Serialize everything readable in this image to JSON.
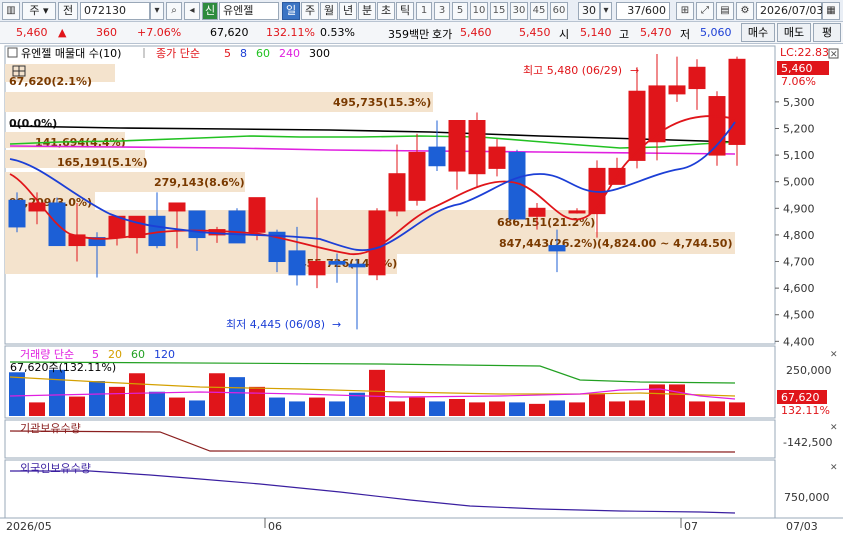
{
  "toolbar": {
    "view_mode": "주",
    "prev_label": "전",
    "stock_code": "072130",
    "market_badge": "신",
    "stock_name": "유엔젤",
    "periods": [
      "일",
      "주",
      "월",
      "년",
      "분",
      "초",
      "틱"
    ],
    "active_period": "일",
    "intervals": [
      "1",
      "3",
      "5",
      "10",
      "15",
      "30",
      "45",
      "60"
    ],
    "interval_value": "30",
    "count_value": "37/600",
    "date_value": "2026/07/03"
  },
  "quote": {
    "price": "5,460",
    "change": "360",
    "change_pct": "+7.06%",
    "volume": "67,620",
    "volume_ratio": "132.11%",
    "turnover": "0.53%",
    "amount": "359백만",
    "ask_label": "호가",
    "ask1": "5,460",
    "ask2": "5,450",
    "open_label": "시",
    "open": "5,140",
    "high_label": "고",
    "high": "5,470",
    "low_label": "저",
    "low": "5,060",
    "buy_button": "매수",
    "sell_button": "매도",
    "eval_button": "평"
  },
  "price_panel": {
    "legend_name": "유엔젤 매물대 수(10)",
    "ma_legend_label": "종가 단순",
    "ma_periods": [
      "5",
      "8",
      "60",
      "240",
      "300"
    ],
    "ma_colors": [
      "#e0151a",
      "#1c3fd6",
      "#22c122",
      "#e020e0",
      "#000000"
    ],
    "lc_label": "LC:22.83",
    "current_price_tag": "5,460",
    "current_pct_tag": "7.06%",
    "high_annotation": "최고 5,480 (06/29)",
    "low_annotation": "최저 4,445 (06/08)",
    "range_annotation": "(4,824.00 ~ 4,744.50)",
    "y_ticks": [
      "5,300",
      "5,200",
      "5,100",
      "5,000",
      "4,900",
      "4,800",
      "4,700",
      "4,600",
      "4,500",
      "4,400"
    ],
    "volume_profile_labels": [
      "67,620(2.1%)",
      "0(0.0%)",
      "495,735(15.3%)",
      "141,694(4.4%)",
      "165,191(5.1%)",
      "279,143(8.6%)",
      "98,209(3.0%)",
      "686,151(21.2%)",
      "847,443(26.2%)",
      "455,726(14.1%)"
    ]
  },
  "volume_panel": {
    "legend_label": "거래량 단순",
    "ma_periods": [
      "5",
      "20",
      "60",
      "120"
    ],
    "ma_colors": [
      "#e020e0",
      "#d4a000",
      "#22a022",
      "#1c3fd6"
    ],
    "info_label": "67,620주(132.11%)",
    "y_tick": "250,000",
    "current_tag": "67,620",
    "current_pct": "132.11%"
  },
  "institution_panel": {
    "legend_label": "기관보유수량",
    "y_tick": "-142,500"
  },
  "foreign_panel": {
    "legend_label": "외국인보유수량",
    "y_tick": "750,000"
  },
  "x_axis": {
    "labels": [
      "2026/05",
      "06",
      "07"
    ],
    "end_label": "07/03"
  },
  "chart_data": {
    "type": "candlestick",
    "ylim": [
      4390,
      5510
    ],
    "candles": [
      {
        "o": 4930,
        "h": 4960,
        "l": 4810,
        "c": 4830
      },
      {
        "o": 4890,
        "h": 4960,
        "l": 4840,
        "c": 4920
      },
      {
        "o": 4920,
        "h": 4940,
        "l": 4760,
        "c": 4760
      },
      {
        "o": 4760,
        "h": 4920,
        "l": 4700,
        "c": 4800
      },
      {
        "o": 4790,
        "h": 4810,
        "l": 4640,
        "c": 4760
      },
      {
        "o": 4790,
        "h": 4870,
        "l": 4760,
        "c": 4870
      },
      {
        "o": 4790,
        "h": 4870,
        "l": 4730,
        "c": 4870
      },
      {
        "o": 4870,
        "h": 4960,
        "l": 4750,
        "c": 4760
      },
      {
        "o": 4890,
        "h": 4910,
        "l": 4750,
        "c": 4920
      },
      {
        "o": 4890,
        "h": 4890,
        "l": 4740,
        "c": 4790
      },
      {
        "o": 4800,
        "h": 4830,
        "l": 4770,
        "c": 4820
      },
      {
        "o": 4890,
        "h": 4900,
        "l": 4770,
        "c": 4770
      },
      {
        "o": 4810,
        "h": 4940,
        "l": 4780,
        "c": 4940
      },
      {
        "o": 4810,
        "h": 4820,
        "l": 4660,
        "c": 4700
      },
      {
        "o": 4740,
        "h": 4830,
        "l": 4610,
        "c": 4650
      },
      {
        "o": 4650,
        "h": 4940,
        "l": 4600,
        "c": 4700
      },
      {
        "o": 4700,
        "h": 4730,
        "l": 4620,
        "c": 4690
      },
      {
        "o": 4690,
        "h": 4710,
        "l": 4445,
        "c": 4680
      },
      {
        "o": 4650,
        "h": 4900,
        "l": 4630,
        "c": 4890
      },
      {
        "o": 4890,
        "h": 5140,
        "l": 4870,
        "c": 5030
      },
      {
        "o": 4930,
        "h": 5180,
        "l": 4910,
        "c": 5110
      },
      {
        "o": 5130,
        "h": 5230,
        "l": 5040,
        "c": 5060
      },
      {
        "o": 5040,
        "h": 5230,
        "l": 4970,
        "c": 5230
      },
      {
        "o": 5030,
        "h": 5260,
        "l": 4980,
        "c": 5230
      },
      {
        "o": 5050,
        "h": 5160,
        "l": 5020,
        "c": 5130
      },
      {
        "o": 5110,
        "h": 5120,
        "l": 4860,
        "c": 4860
      },
      {
        "o": 4870,
        "h": 4920,
        "l": 4820,
        "c": 4900
      },
      {
        "o": 4760,
        "h": 4820,
        "l": 4660,
        "c": 4740
      },
      {
        "o": 4890,
        "h": 4900,
        "l": 4880,
        "c": 4890
      },
      {
        "o": 4880,
        "h": 5080,
        "l": 4790,
        "c": 5050
      },
      {
        "o": 4990,
        "h": 5090,
        "l": 4990,
        "c": 5050
      },
      {
        "o": 5080,
        "h": 5430,
        "l": 5050,
        "c": 5340
      },
      {
        "o": 5150,
        "h": 5480,
        "l": 5080,
        "c": 5360
      },
      {
        "o": 5330,
        "h": 5470,
        "l": 5300,
        "c": 5360
      },
      {
        "o": 5350,
        "h": 5460,
        "l": 5270,
        "c": 5430
      },
      {
        "o": 5100,
        "h": 5340,
        "l": 5060,
        "c": 5320
      },
      {
        "o": 5140,
        "h": 5470,
        "l": 5060,
        "c": 5460
      }
    ],
    "volume_values": [
      90,
      28,
      95,
      40,
      72,
      60,
      88,
      50,
      38,
      32,
      88,
      80,
      60,
      38,
      30,
      38,
      30,
      48,
      95,
      30,
      38,
      30,
      35,
      28,
      30,
      28,
      25,
      32,
      28,
      45,
      30,
      32,
      65,
      65,
      30,
      30,
      28
    ],
    "volume_ylim": [
      0,
      140
    ]
  }
}
